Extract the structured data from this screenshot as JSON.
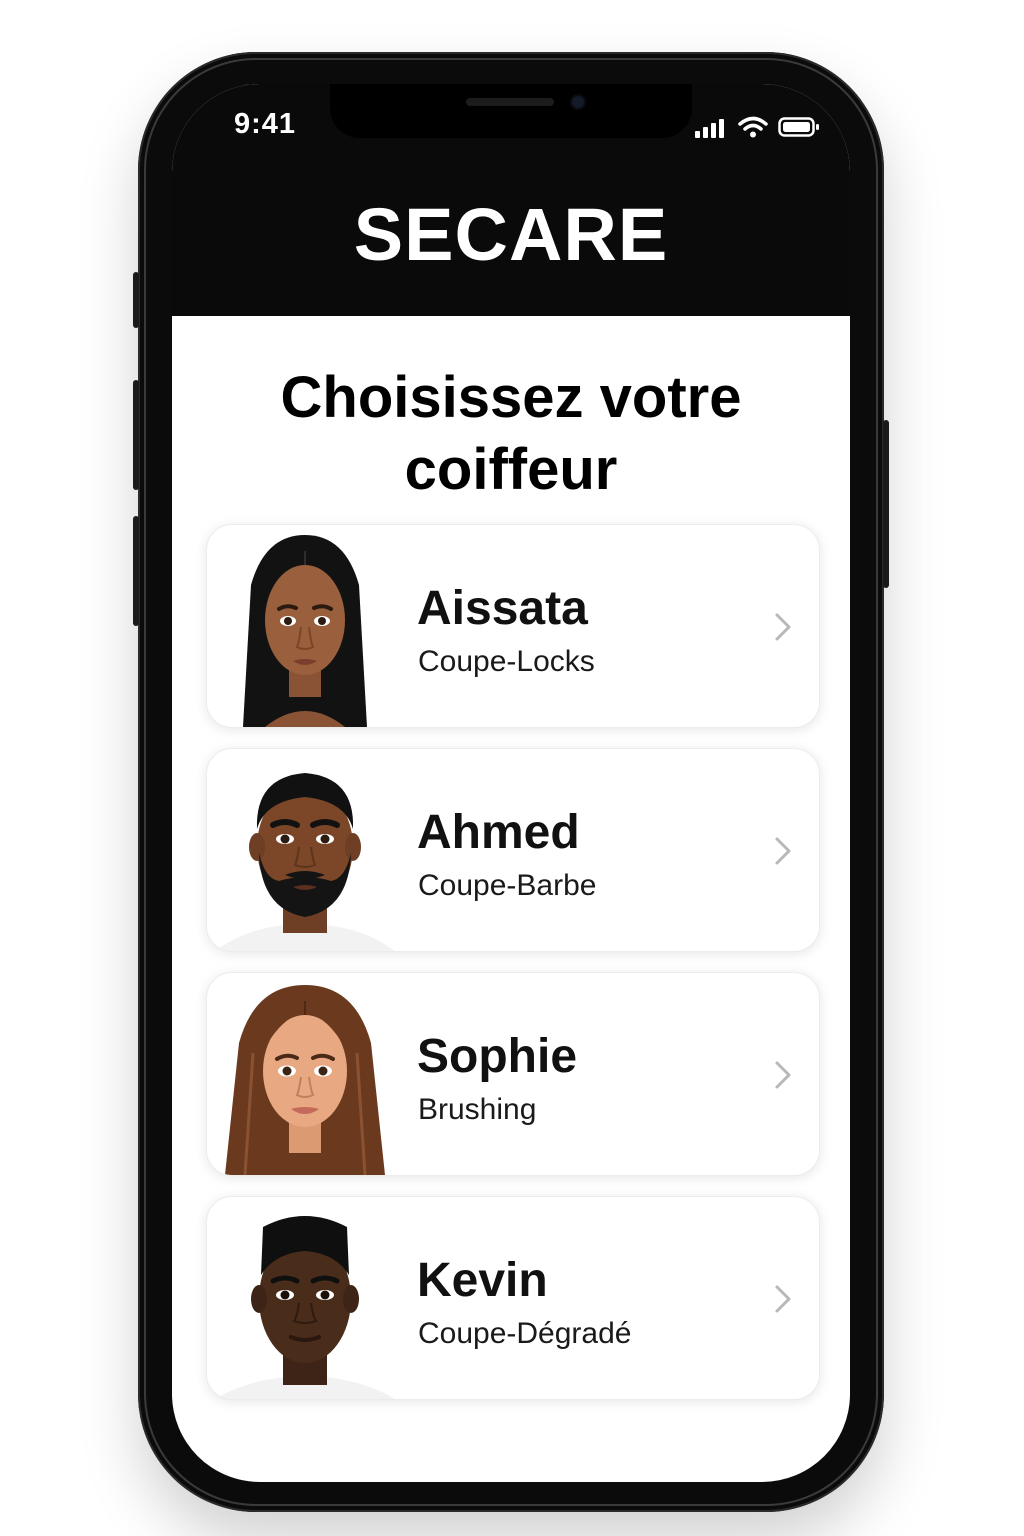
{
  "status_bar": {
    "time": "9:41"
  },
  "app": {
    "brand": "SECARE"
  },
  "page": {
    "title": "Choisissez votre coiffeur"
  },
  "barbers": [
    {
      "name": "Aissata",
      "service": "Coupe-Locks"
    },
    {
      "name": "Ahmed",
      "service": "Coupe-Barbe"
    },
    {
      "name": "Sophie",
      "service": "Brushing"
    },
    {
      "name": "Kevin",
      "service": "Coupe-Dégradé"
    }
  ],
  "colors": {
    "header_bg": "#0a0a0a",
    "text": "#000000",
    "chevron": "#b8b8b8",
    "card_bg": "#ffffff"
  }
}
